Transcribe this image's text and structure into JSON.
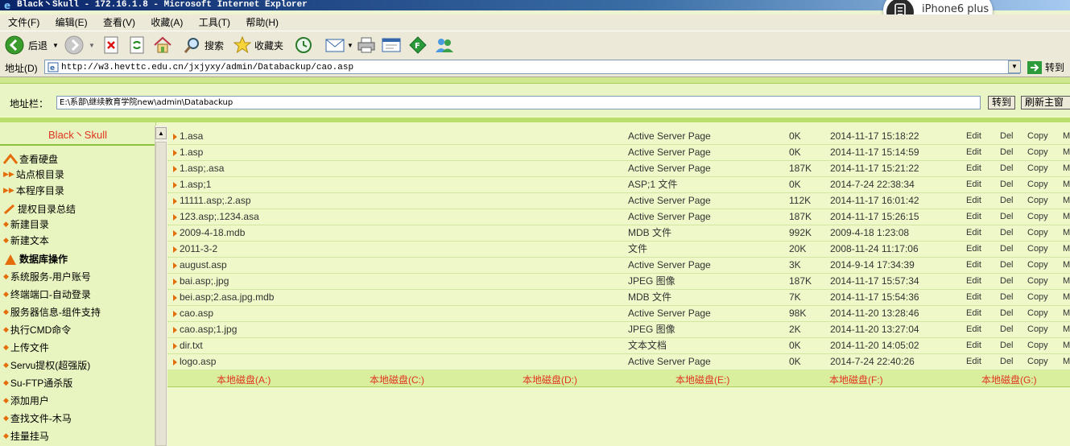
{
  "window": {
    "title": "Black丶Skull - 172.16.1.8 - Microsoft Internet Explorer"
  },
  "phone_badge": {
    "label": "iPhone6 plus"
  },
  "menu": [
    "文件(F)",
    "编辑(E)",
    "查看(V)",
    "收藏(A)",
    "工具(T)",
    "帮助(H)"
  ],
  "toolbar": {
    "back_label": "后退",
    "search_label": "搜索",
    "favorites_label": "收藏夹"
  },
  "address": {
    "label": "地址(D)",
    "url": "http://w3.hevttc.edu.cn/jxjyxy/admin/Databackup/cao.asp",
    "go_label": "转到"
  },
  "pathbar": {
    "label": "地址栏：",
    "value": "E:\\系部\\继续教育学院new\\admin\\Databackup",
    "go_label": "转到",
    "refresh_label": "刷新主窗"
  },
  "sidebar": {
    "brand": "Black丶Skull",
    "items": [
      "查看硬盘",
      "站点根目录",
      "本程序目录",
      "提权目录总结",
      "新建目录",
      "新建文本",
      "数据库操作",
      "系统服务-用户账号",
      "终端端口-自动登录",
      "服务器信息-组件支持",
      "执行CMD命令",
      "上传文件",
      "Servu提权(超强版)",
      "Su-FTP通杀版",
      "添加用户",
      "查找文件-木马",
      "挂量挂马"
    ]
  },
  "files": [
    {
      "name": "1.asa",
      "type": "Active Server Page",
      "size": "0K",
      "time": "2014-11-17 15:18:22"
    },
    {
      "name": "1.asp",
      "type": "Active Server Page",
      "size": "0K",
      "time": "2014-11-17 15:14:59"
    },
    {
      "name": "1.asp;.asa",
      "type": "Active Server Page",
      "size": "187K",
      "time": "2014-11-17 15:21:22"
    },
    {
      "name": "1.asp;1",
      "type": "ASP;1 文件",
      "size": "0K",
      "time": "2014-7-24 22:38:34"
    },
    {
      "name": "11111.asp;.2.asp",
      "type": "Active Server Page",
      "size": "112K",
      "time": "2014-11-17 16:01:42"
    },
    {
      "name": "123.asp;.1234.asa",
      "type": "Active Server Page",
      "size": "187K",
      "time": "2014-11-17 15:26:15"
    },
    {
      "name": "2009-4-18.mdb",
      "type": "MDB 文件",
      "size": "992K",
      "time": "2009-4-18 1:23:08"
    },
    {
      "name": "2011-3-2",
      "type": "文件",
      "size": "20K",
      "time": "2008-11-24 11:17:06"
    },
    {
      "name": "august.asp",
      "type": "Active Server Page",
      "size": "3K",
      "time": "2014-9-14 17:34:39"
    },
    {
      "name": "bai.asp;.jpg",
      "type": "JPEG 图像",
      "size": "187K",
      "time": "2014-11-17 15:57:34"
    },
    {
      "name": "bei.asp;2.asa.jpg.mdb",
      "type": "MDB 文件",
      "size": "7K",
      "time": "2014-11-17 15:54:36"
    },
    {
      "name": "cao.asp",
      "type": "Active Server Page",
      "size": "98K",
      "time": "2014-11-20 13:28:46"
    },
    {
      "name": "cao.asp;1.jpg",
      "type": "JPEG 图像",
      "size": "2K",
      "time": "2014-11-20 13:27:04"
    },
    {
      "name": "dir.txt",
      "type": "文本文档",
      "size": "0K",
      "time": "2014-11-20 14:05:02"
    },
    {
      "name": "logo.asp",
      "type": "Active Server Page",
      "size": "0K",
      "time": "2014-7-24 22:40:26"
    }
  ],
  "actions": [
    "Edit",
    "Del",
    "Copy",
    "Mo"
  ],
  "drives": [
    "本地磁盘(A:)",
    "本地磁盘(C:)",
    "本地磁盘(D:)",
    "本地磁盘(E:)",
    "本地磁盘(F:)",
    "本地磁盘(G:)"
  ]
}
